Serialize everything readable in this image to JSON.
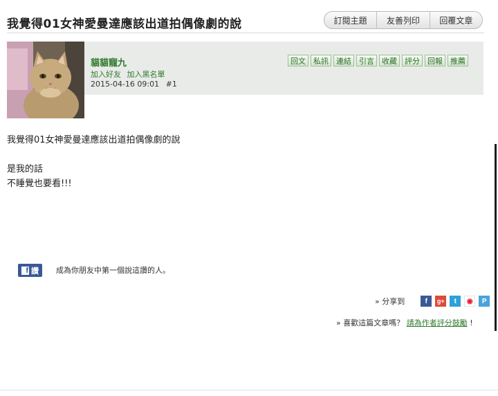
{
  "thread": {
    "title": "我覺得01女神愛曼達應該出道拍偶像劇的說",
    "actions": [
      "訂閱主題",
      "友善列印",
      "回覆文章"
    ]
  },
  "post": {
    "author": {
      "name": "貓貓寵九",
      "add_friend": "加入好友",
      "add_blacklist": "加入黑名單"
    },
    "timestamp": "2015-04-16 09:01",
    "floor": "#1",
    "tools": [
      "回文",
      "私訊",
      "連結",
      "引言",
      "收藏",
      "評分",
      "回報",
      "推薦"
    ],
    "body": {
      "line1": "我覺得01女神愛曼達應該出道拍偶像劇的說",
      "line2": "是我的話",
      "line3": "不睡覺也要看!!!"
    }
  },
  "facebook": {
    "like_label": "讚",
    "note": "成為你朋友中第一個說這讚的人。"
  },
  "share": {
    "label": "» 分享到",
    "icons": [
      {
        "name": "facebook-share-icon",
        "glyph": "f",
        "color": "#3b5998"
      },
      {
        "name": "google-plus-share-icon",
        "glyph": "g+",
        "color": "#dd4b39"
      },
      {
        "name": "twitter-share-icon",
        "glyph": "t",
        "color": "#2ea0dc"
      },
      {
        "name": "weibo-share-icon",
        "glyph": "◉",
        "color": "#e6162d"
      },
      {
        "name": "plurk-share-icon",
        "glyph": "P",
        "color": "#4aa3df"
      }
    ]
  },
  "rating": {
    "prefix": "» 喜歡這篇文章嗎？",
    "link": "請為作者評分鼓勵",
    "suffix": "!"
  }
}
